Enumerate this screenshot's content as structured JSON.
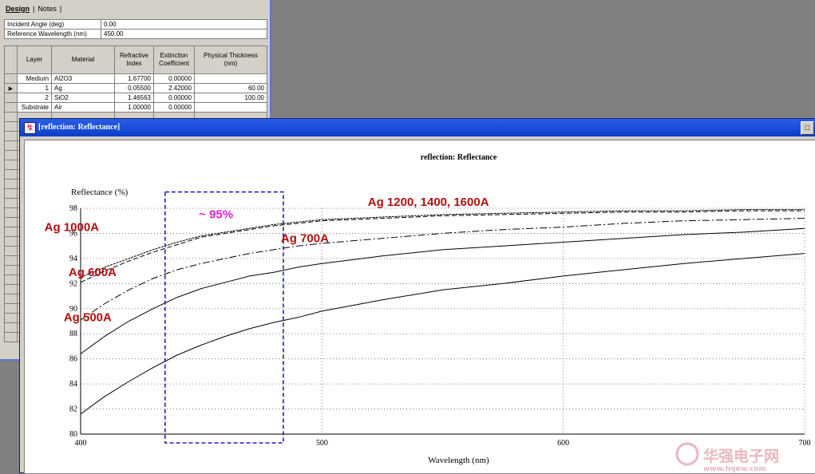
{
  "design_window": {
    "tabs": [
      {
        "label": "Design",
        "active": true
      },
      {
        "label": "Notes",
        "active": false
      }
    ],
    "params": [
      {
        "label": "Incident Angle (deg)",
        "value": "0.00"
      },
      {
        "label": "Reference Wavelength (nm)",
        "value": "450.00"
      }
    ],
    "columns": [
      "Layer",
      "Material",
      "Refractive Index",
      "Extinction Coefficient",
      "Physical Thickness (nm)"
    ],
    "rows": [
      {
        "layer": "Medium",
        "material": "Al2O3",
        "n": "1.67700",
        "k": "0.00000",
        "t": ""
      },
      {
        "layer": "1",
        "material": "Ag",
        "n": "0.05500",
        "k": "2.42000",
        "t": "60.00",
        "current": true
      },
      {
        "layer": "2",
        "material": "SiO2",
        "n": "1.46563",
        "k": "0.00000",
        "t": "100.00"
      },
      {
        "layer": "Substrate",
        "material": "Air",
        "n": "1.00000",
        "k": "0.00000",
        "t": ""
      }
    ]
  },
  "chart_window": {
    "title": "[reflection: Reflectance]",
    "close_glyph": "□",
    "icon_glyph": "↯"
  },
  "chart_data": {
    "type": "line",
    "title": "reflection: Reflectance",
    "xlabel": "Wavelength (nm)",
    "ylabel": "Reflectance (%)",
    "xlim": [
      400,
      700
    ],
    "ylim": [
      80,
      98
    ],
    "xticks": [
      400,
      500,
      600,
      700
    ],
    "yticks": [
      80,
      82,
      84,
      86,
      88,
      90,
      92,
      94,
      96,
      98
    ],
    "grid": true,
    "series": [
      {
        "label": "Ag  500A",
        "style": "solid",
        "x": [
          400,
          410,
          420,
          430,
          440,
          450,
          460,
          470,
          480,
          490,
          500,
          525,
          550,
          575,
          600,
          625,
          650,
          675,
          700
        ],
        "y": [
          81.6,
          83.0,
          84.2,
          85.3,
          86.3,
          87.1,
          87.8,
          88.4,
          88.9,
          89.3,
          89.8,
          90.7,
          91.5,
          92.0,
          92.6,
          93.1,
          93.6,
          94.0,
          94.4
        ]
      },
      {
        "label": "Ag  600A",
        "style": "solid",
        "x": [
          400,
          410,
          420,
          430,
          440,
          450,
          460,
          470,
          480,
          490,
          500,
          525,
          550,
          575,
          600,
          625,
          650,
          675,
          700
        ],
        "y": [
          86.4,
          87.8,
          89.0,
          90.0,
          90.9,
          91.6,
          92.1,
          92.6,
          92.9,
          93.3,
          93.6,
          94.2,
          94.7,
          95.0,
          95.3,
          95.6,
          95.9,
          96.1,
          96.4
        ]
      },
      {
        "label": "Ag  700A",
        "style": "dashdot",
        "x": [
          400,
          410,
          420,
          430,
          440,
          450,
          460,
          470,
          480,
          490,
          500,
          525,
          550,
          575,
          600,
          625,
          650,
          675,
          700
        ],
        "y": [
          89.1,
          90.4,
          91.5,
          92.4,
          93.1,
          93.6,
          94.0,
          94.4,
          94.7,
          95.0,
          95.2,
          95.6,
          96.0,
          96.3,
          96.5,
          96.8,
          97.0,
          97.1,
          97.2
        ]
      },
      {
        "label": "Ag  1000A",
        "style": "dash",
        "x": [
          400,
          410,
          420,
          430,
          440,
          450,
          460,
          470,
          480,
          490,
          500,
          525,
          550,
          575,
          600,
          625,
          650,
          675,
          700
        ],
        "y": [
          92.1,
          93.0,
          93.8,
          94.5,
          95.1,
          95.7,
          96.0,
          96.3,
          96.6,
          96.8,
          97.0,
          97.2,
          97.4,
          97.5,
          97.6,
          97.7,
          97.7,
          97.8,
          97.8
        ]
      },
      {
        "label": "Ag  1200, 1400, 1600A",
        "style": "dense",
        "x": [
          400,
          410,
          420,
          430,
          440,
          450,
          460,
          470,
          480,
          490,
          500,
          525,
          550,
          575,
          600,
          625,
          650,
          675,
          700
        ],
        "y": [
          92.5,
          93.3,
          94.0,
          94.7,
          95.3,
          95.8,
          96.1,
          96.4,
          96.7,
          96.9,
          97.1,
          97.3,
          97.5,
          97.6,
          97.7,
          97.8,
          97.8,
          97.9,
          97.9
        ]
      }
    ],
    "annotations": [
      {
        "text": "~ 95%",
        "x": 449,
        "y": 97.2,
        "color": "#e020d0"
      },
      {
        "text": "Ag  1200, 1400, 1600A",
        "x": 519,
        "y": 98.2,
        "color": "#b01010"
      },
      {
        "text": "Ag  1000A",
        "x": 385,
        "y": 96.2,
        "color": "#b01010"
      },
      {
        "text": "Ag  700A",
        "x": 483,
        "y": 95.3,
        "color": "#b01010"
      },
      {
        "text": "Ag  600A",
        "x": 395,
        "y": 92.6,
        "color": "#b01010"
      },
      {
        "text": "Ag  500A",
        "x": 393,
        "y": 89.0,
        "color": "#b01010"
      }
    ],
    "highlight_box": {
      "x0": 435,
      "x1": 484,
      "y0": 99.3,
      "y1": 79.3,
      "color": "#2020c0"
    },
    "watermark": {
      "text": "华强电子网",
      "url_text": "www.hqew.com",
      "color": "#e8b8c0"
    }
  }
}
